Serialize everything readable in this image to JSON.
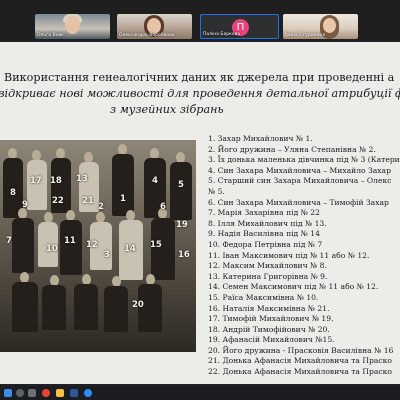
{
  "participants": [
    {
      "name": "Ольга Вовк"
    },
    {
      "name": "Олександра Воробйова"
    },
    {
      "name": "Поліна Баркова",
      "initial": "П"
    },
    {
      "name": "Ірина Студениця"
    }
  ],
  "slide": {
    "title_line1": "Використання генеалогічних даних як джерела при проведенні а",
    "title_line2": "відкриває нові можливості для проведення детальної атрибуції фот",
    "title_line3": "з музейних зібрань",
    "photo_tags": [
      "1",
      "2",
      "3",
      "4",
      "5",
      "6",
      "7",
      "8",
      "9",
      "10",
      "11",
      "12",
      "13",
      "14",
      "15",
      "16",
      "17",
      "18",
      "19",
      "20",
      "21",
      "22"
    ],
    "names": [
      "1. Захар Михайлович № 1.",
      "2. Його дружина – Уляна Степанівна № 2.",
      "3. Їх донька маленька дівчинка під № 3 (Катери",
      "4. Син Захара Михайловича – Михайло Захар",
      "5. Старший син Захара Михайловича – Олекс",
      "№ 5.",
      "6. Син Захара Михайловича – Тимофій Захар",
      "7. Марія Захарівна під № 22",
      "8. Ілля Михайлович під № 13.",
      "9. Надія Василівна під № 14",
      "10. Федора Петрівна під № 7",
      "11. Іван Максимович під № 11 або № 12.",
      "12. Максим Михайлович № 8.",
      "13. Катерина Григорівна № 9.",
      "14. Семен Максимович під № 11 або № 12.",
      "15. Раїса Максимівна № 10.",
      "16. Наталія Максимівна № 21.",
      "17. Тимофій Михайлович № 19.",
      "18. Андрій Тимофійович № 20.",
      "19. Афанасій Михайлович №15.",
      "20. Його дружина - Прасковія Василівна № 16",
      "21. Донька Афанасія Михайловича та Праско",
      "22. Донька Афанасія Михайловича та Праско"
    ]
  },
  "colors": {
    "slide_bg": "#ecece8",
    "active_speaker_border": "#1a73e8",
    "avatar_bg": "#e8437a",
    "taskbar_bg": "#1b1d22"
  },
  "taskbar_icons": [
    "windows-start-icon",
    "search-icon",
    "task-view-icon",
    "chrome-icon",
    "explorer-icon",
    "word-icon",
    "zoom-icon"
  ]
}
